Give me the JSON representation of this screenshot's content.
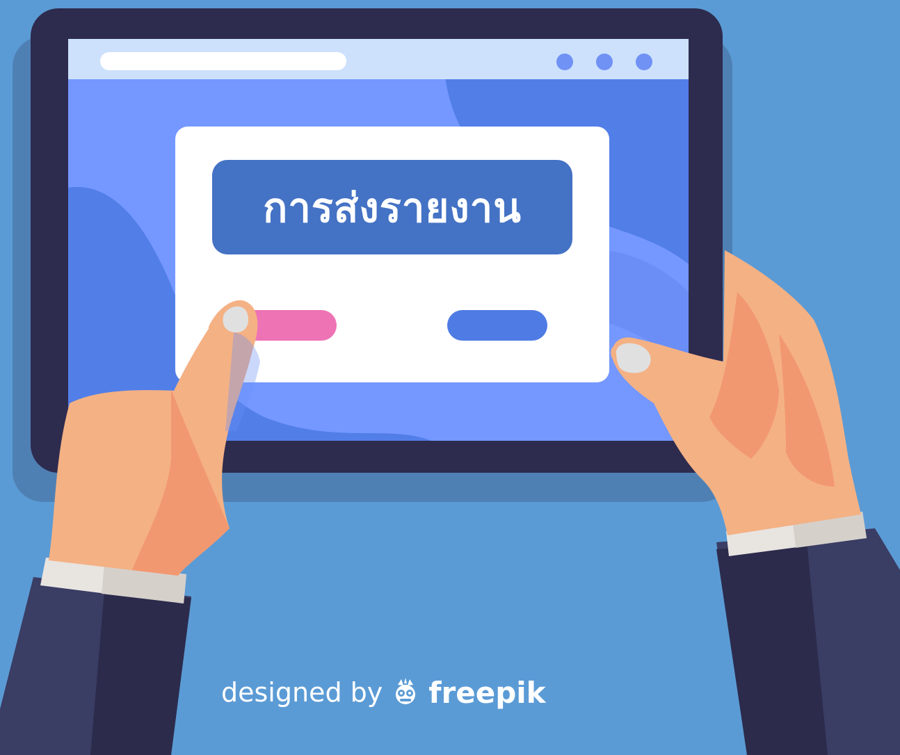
{
  "screen": {
    "title": "การส่งรายงาน",
    "left_button_color": "#ee73b5",
    "right_button_color": "#4f7be4"
  },
  "credit": {
    "prefix": "designed by",
    "brand": "freepik",
    "logo_icon": "freepik-logo-icon"
  },
  "colors": {
    "background": "#5b9bd5",
    "tablet_frame": "#2d2b4e",
    "screen_light": "#7498ff",
    "screen_dark": "#527ee8",
    "card": "#ffffff",
    "title_badge": "#4472c4",
    "skin": "#f4b184",
    "skin_shadow": "#f29870",
    "sleeve": "#3a3d64",
    "sleeve_dark": "#2c2b4c",
    "cuff": "#e8e4e0"
  }
}
